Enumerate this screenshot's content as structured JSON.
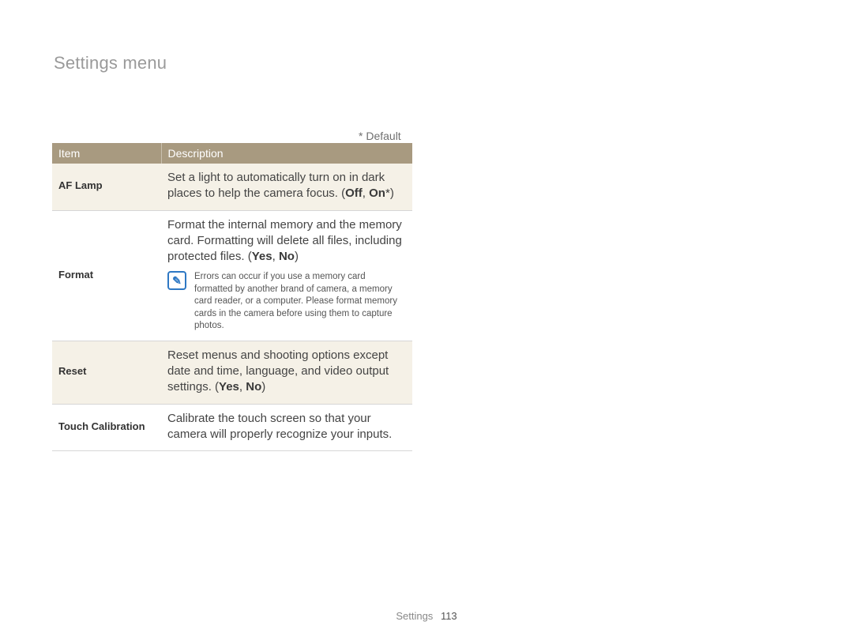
{
  "title": "Settings menu",
  "default_note": "* Default",
  "headers": {
    "item": "Item",
    "description": "Description"
  },
  "rows": [
    {
      "item": "AF Lamp",
      "desc_pre": "Set a light to automatically turn on in dark places to help the camera focus. (",
      "opt1": "Off",
      "sep": ", ",
      "opt2": "On",
      "star": "*",
      "desc_post": ")"
    },
    {
      "item": "Format",
      "desc_pre": "Format the internal memory and the memory card. Formatting will delete all files, including protected files. (",
      "opt1": "Yes",
      "sep": ", ",
      "opt2": "No",
      "desc_post": ")",
      "note_icon": "✎",
      "note": "Errors can occur if you use a memory card formatted by another brand of camera, a memory card reader, or a computer. Please format memory cards in the camera before using them to capture photos."
    },
    {
      "item": "Reset",
      "desc_pre": "Reset menus and shooting options except date and time, language, and video output settings. (",
      "opt1": "Yes",
      "sep": ", ",
      "opt2": "No",
      "desc_post": ")"
    },
    {
      "item": "Touch Calibration",
      "desc_pre": "Calibrate the touch screen so that your camera will properly recognize your inputs."
    }
  ],
  "footer": {
    "section": "Settings",
    "page": "113"
  }
}
